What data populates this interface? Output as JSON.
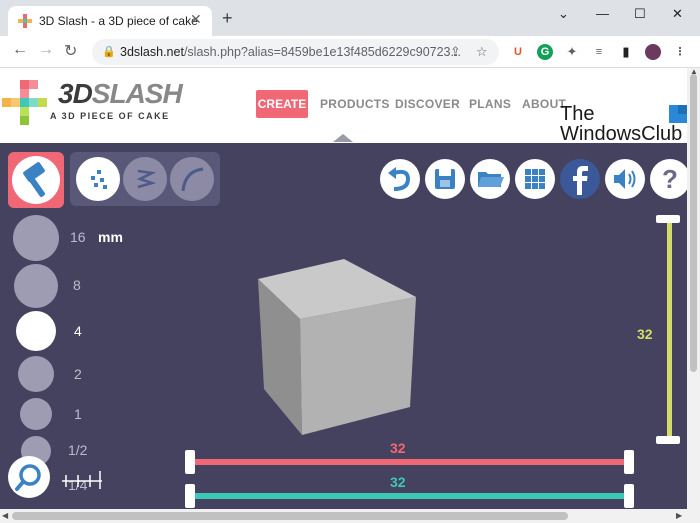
{
  "browser": {
    "tab_title": "3D Slash - a 3D piece of cake",
    "new_tab": "+",
    "url_domain": "3dslash.net",
    "url_path": "/slash.php?alias=8459be1e13f485d6229c90723..."
  },
  "site": {
    "logo_text_a": "3D",
    "logo_text_b": "SLASH",
    "tagline": "A 3D PIECE OF CAKE",
    "nav": {
      "create": "CREATE",
      "products": "PRODUCTS",
      "discover": "DISCOVER",
      "plans": "PLANS",
      "about": "ABOUT"
    }
  },
  "watermark": {
    "line1": "The",
    "line2": "WindowsClub"
  },
  "editor": {
    "unit": "mm",
    "sizes": [
      "16",
      "8",
      "4",
      "2",
      "1",
      "1/2",
      "1/4"
    ],
    "active_size": "4",
    "vertical_value": "32",
    "red_value": "32",
    "teal_value": "32"
  },
  "colors": {
    "accent": "#f06876",
    "workspace": "#44425e",
    "yellow_axis": "#d4dc6a",
    "red_axis": "#f06876",
    "teal_axis": "#3ec9b6"
  },
  "icons": {
    "tools": [
      "hammer-icon",
      "dots-icon",
      "zigzag-icon",
      "curve-icon"
    ],
    "right": [
      "undo-icon",
      "save-icon",
      "folder-icon",
      "grid-icon",
      "facebook-icon",
      "sound-icon",
      "help-icon"
    ]
  }
}
